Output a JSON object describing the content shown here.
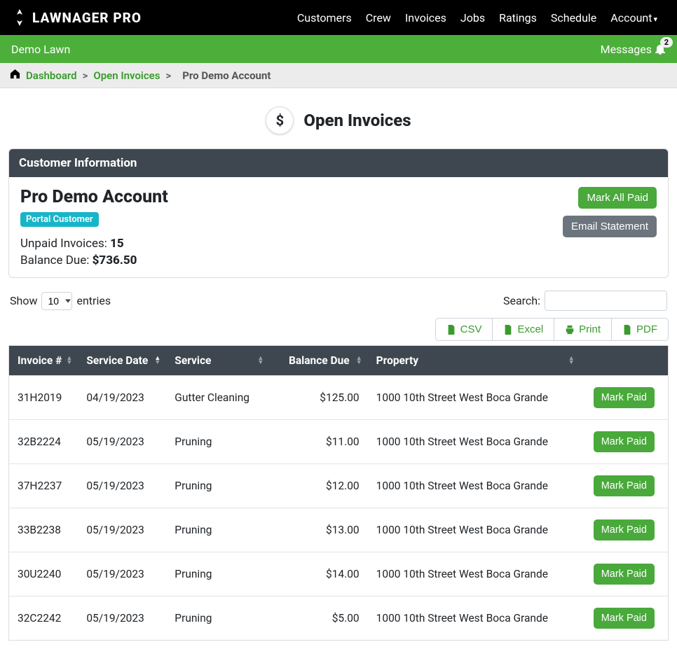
{
  "brand": "LAWNAGER PRO",
  "topnav": [
    "Customers",
    "Crew",
    "Invoices",
    "Jobs",
    "Ratings",
    "Schedule",
    "Account"
  ],
  "greenbar": {
    "company": "Demo Lawn",
    "messages_label": "Messages",
    "messages_count": "2"
  },
  "breadcrumb": {
    "items": [
      "Dashboard",
      "Open Invoices"
    ],
    "current": "Pro Demo Account"
  },
  "title": "Open Invoices",
  "card_header": "Customer Information",
  "customer": {
    "name": "Pro Demo Account",
    "chip": "Portal Customer",
    "unpaid_label": "Unpaid Invoices: ",
    "unpaid_value": "15",
    "balance_label": "Balance Due: ",
    "balance_value": "$736.50",
    "mark_all": "Mark All Paid",
    "email_statement": "Email Statement"
  },
  "controls": {
    "show": "Show",
    "select_value": "10",
    "entries": "entries",
    "search_label": "Search:"
  },
  "exports": {
    "csv": "CSV",
    "excel": "Excel",
    "print": "Print",
    "pdf": "PDF"
  },
  "table": {
    "headers": [
      "Invoice #",
      "Service Date",
      "Service",
      "Balance Due",
      "Property",
      ""
    ],
    "sort_col": 1,
    "sort_dir": "asc",
    "mark_paid": "Mark Paid",
    "rows": [
      {
        "invoice": "31H2019",
        "date": "04/19/2023",
        "service": "Gutter Cleaning",
        "balance": "$125.00",
        "property": "1000 10th Street West Boca Grande"
      },
      {
        "invoice": "32B2224",
        "date": "05/19/2023",
        "service": "Pruning",
        "balance": "$11.00",
        "property": "1000 10th Street West Boca Grande"
      },
      {
        "invoice": "37H2237",
        "date": "05/19/2023",
        "service": "Pruning",
        "balance": "$12.00",
        "property": "1000 10th Street West Boca Grande"
      },
      {
        "invoice": "33B2238",
        "date": "05/19/2023",
        "service": "Pruning",
        "balance": "$13.00",
        "property": "1000 10th Street West Boca Grande"
      },
      {
        "invoice": "30U2240",
        "date": "05/19/2023",
        "service": "Pruning",
        "balance": "$14.00",
        "property": "1000 10th Street West Boca Grande"
      },
      {
        "invoice": "32C2242",
        "date": "05/19/2023",
        "service": "Pruning",
        "balance": "$5.00",
        "property": "1000 10th Street West Boca Grande"
      }
    ]
  }
}
